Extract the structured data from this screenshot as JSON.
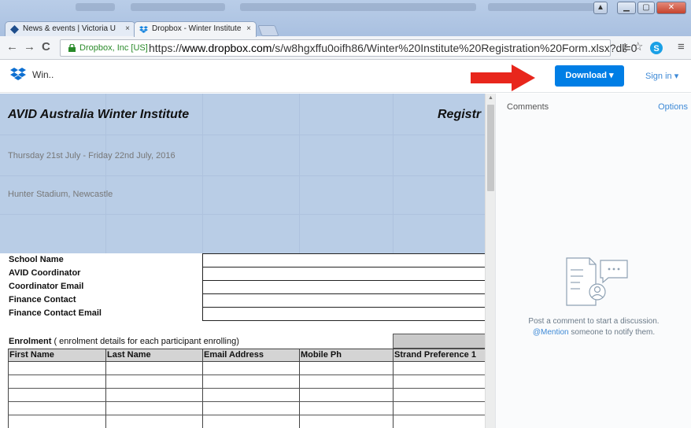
{
  "browser": {
    "tabs": [
      {
        "label": "News & events | Victoria U",
        "active": false
      },
      {
        "label": "Dropbox - Winter Institute",
        "active": true
      }
    ],
    "tab_close_glyph": "×",
    "ev_label": "Dropbox, Inc [US]",
    "url_scheme": "https://",
    "url_host": "www.dropbox.com",
    "url_path": "/s/w8hgxffu0oifh86/Winter%20Institute%20Registration%20Form.xlsx?dl=0",
    "icons": [
      "back-icon",
      "forward-icon",
      "reload-icon",
      "lock-icon",
      "key-icon",
      "star-icon",
      "skype-icon",
      "menu-icon"
    ]
  },
  "header": {
    "filename": "Win..",
    "download_label": "Download ▾",
    "signin_label": "Sign in ▾"
  },
  "sheet": {
    "title": "AVID Australia Winter Institute",
    "title_right": "Registr",
    "dates": "Thursday 21st July - Friday 22nd July, 2016",
    "venue": "Hunter Stadium, Newcastle",
    "form_labels": [
      "School Name",
      "AVID Coordinator",
      "Coordinator Email",
      "Finance Contact",
      "Finance Contact Email"
    ],
    "enrolment_bold": "Enrolment",
    "enrolment_note": " ( enrolment details for each participant enrolling)",
    "columns": [
      "First Name",
      "Last Name",
      "Email Address",
      "Mobile Ph",
      "Strand Preference 1"
    ]
  },
  "comments": {
    "title": "Comments",
    "options": "Options",
    "message_line1": "Post a comment to start a discussion.",
    "mention": "@Mention",
    "message_line2_rest": " someone to notify them."
  },
  "colors": {
    "download_button": "#007ee5",
    "link": "#3d89d6",
    "sheet_banner": "#b9cde6",
    "arrow": "#e8261c"
  }
}
